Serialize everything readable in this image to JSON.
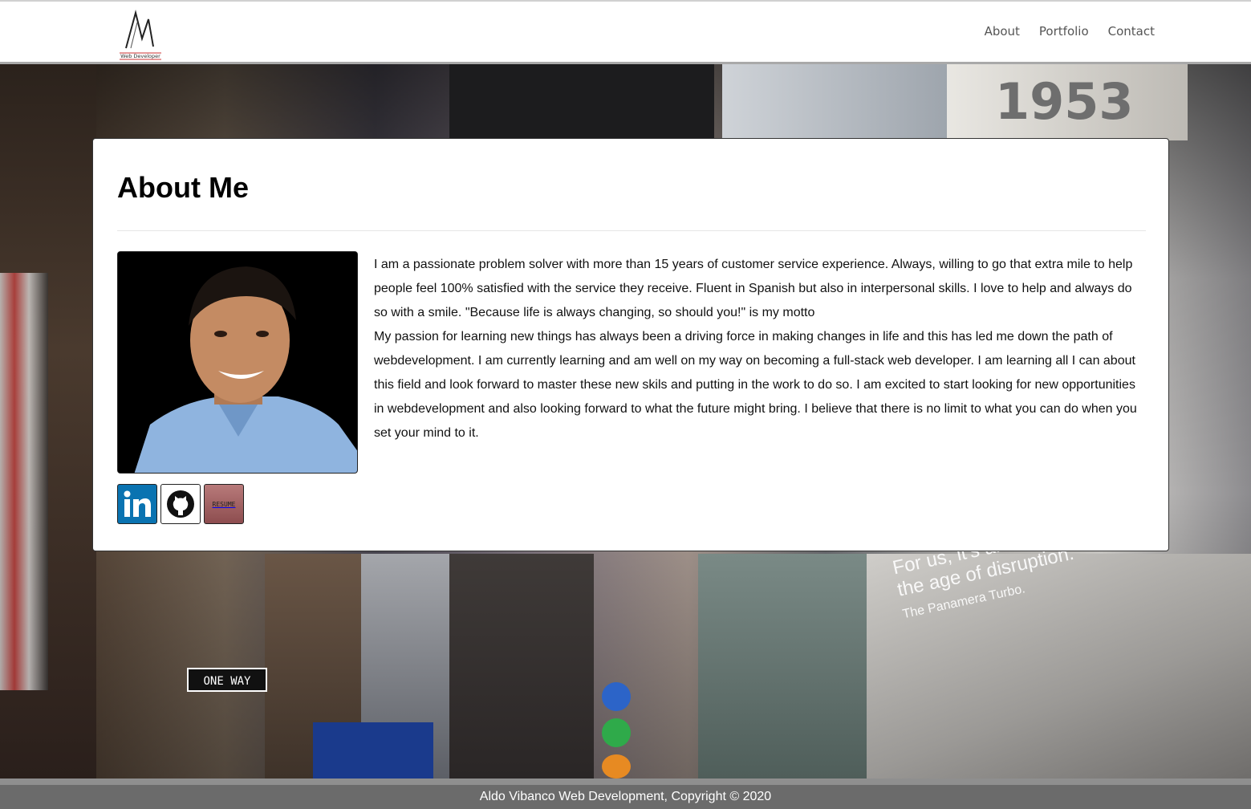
{
  "header": {
    "logo_text": "Web Developer",
    "nav": [
      {
        "label": "About"
      },
      {
        "label": "Portfolio"
      },
      {
        "label": "Contact"
      }
    ]
  },
  "about": {
    "title": "About Me",
    "paragraph1": "I am a passionate problem solver with more than 15 years of customer service experience. Always, willing to go that extra mile to help people feel 100% satisfied with the service they receive. Fluent in Spanish but also in interpersonal skills. I love to help and always do so with a smile. \"Because life is always changing, so should you!\" is my motto",
    "paragraph2": "My passion for learning new things has always been a driving force in making changes in life and this has led me down the path of webdevelopment. I am currently learning and am well on my way on becoming a full-stack web developer. I am learning all I can about this field and look forward to master these new skils and putting in the work to do so. I am excited to start looking for new opportunities in webdevelopment and also looking forward to what the future might bring. I believe that there is no limit to what you can do when you set your mind to it.",
    "resume_label": "RESUME"
  },
  "footer": {
    "text": "Aldo Vibanco Web Development, Copyright © 2020"
  },
  "icons": [
    "linkedin-icon",
    "github-icon",
    "resume-icon"
  ],
  "colors": {
    "linkedin": "#0a73b1",
    "footer_bg": "#6b6b6b",
    "nav_text": "#555555"
  }
}
